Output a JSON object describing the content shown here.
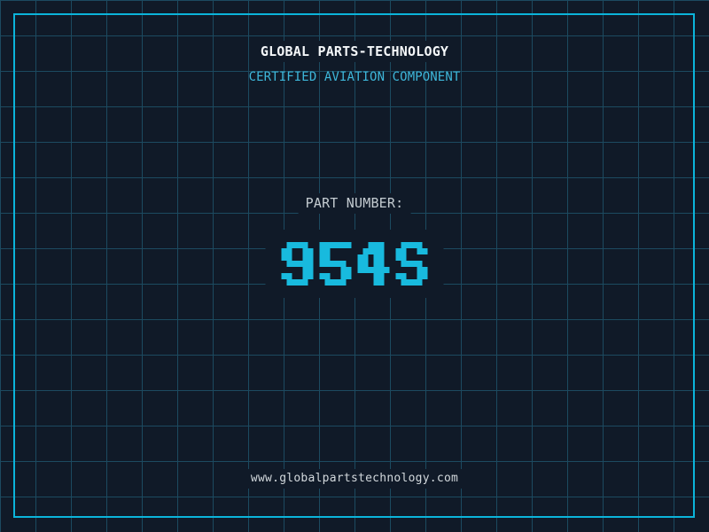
{
  "header": {
    "title": "GLOBAL PARTS-TECHNOLOGY",
    "subtitle": "CERTIFIED AVIATION COMPONENT"
  },
  "part": {
    "label": "PART NUMBER:",
    "value": "954S"
  },
  "footer": {
    "url": "www.globalpartstechnology.com"
  },
  "colors": {
    "background": "#101a28",
    "grid_line": "#1c4a60",
    "frame": "#0bb4da",
    "title": "#f4f7f9",
    "subtitle": "#3eb7da",
    "part_label": "#c4ccd1",
    "part_value": "#18bade",
    "url": "#d2d8dc"
  }
}
